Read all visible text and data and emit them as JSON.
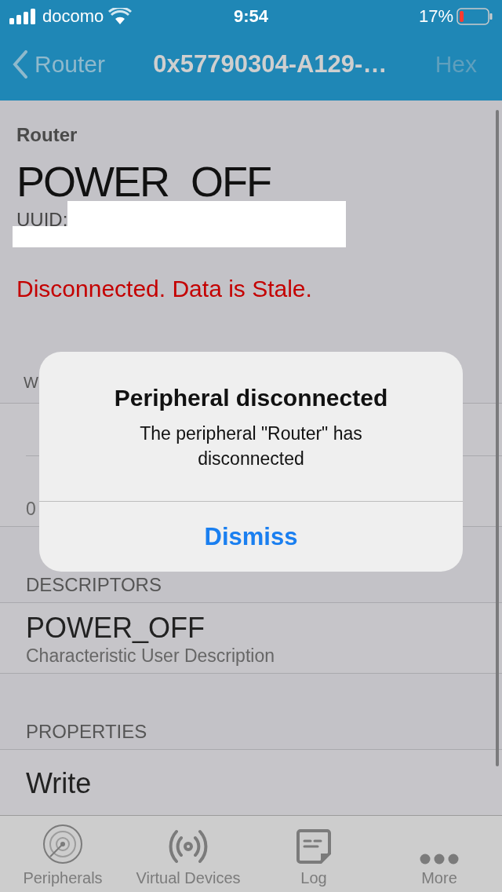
{
  "status_bar": {
    "carrier": "docomo",
    "time": "9:54",
    "battery": "17%"
  },
  "nav_bar": {
    "back": "Router",
    "title": "0x57790304-A129-…",
    "action": "Hex"
  },
  "header": {
    "peripheral": "Router",
    "name": "POWER_OFF",
    "uuid_label": "UUID:",
    "status": "Disconnected. Data is Stale."
  },
  "sections": [
    {
      "header": "W",
      "rows": [
        {
          "kind": "plain"
        },
        {
          "kind": "detail",
          "subtitle": "0"
        }
      ]
    },
    {
      "header": "DESCRIPTORS",
      "rows": [
        {
          "kind": "detail",
          "title": "POWER_OFF",
          "subtitle": "Characteristic User Description"
        }
      ]
    },
    {
      "header": "PROPERTIES",
      "rows": [
        {
          "kind": "plain",
          "title": "Write"
        }
      ]
    }
  ],
  "alert": {
    "title": "Peripheral disconnected",
    "message": "The peripheral \"Router\" has disconnected",
    "button": "Dismiss"
  },
  "tabs": [
    {
      "kind": "radar",
      "label": "Peripherals",
      "selected": false
    },
    {
      "kind": "broadcast",
      "label": "Virtual Devices",
      "selected": false
    },
    {
      "kind": "note",
      "label": "Log",
      "selected": false
    },
    {
      "kind": "more",
      "label": "More",
      "selected": false
    }
  ]
}
